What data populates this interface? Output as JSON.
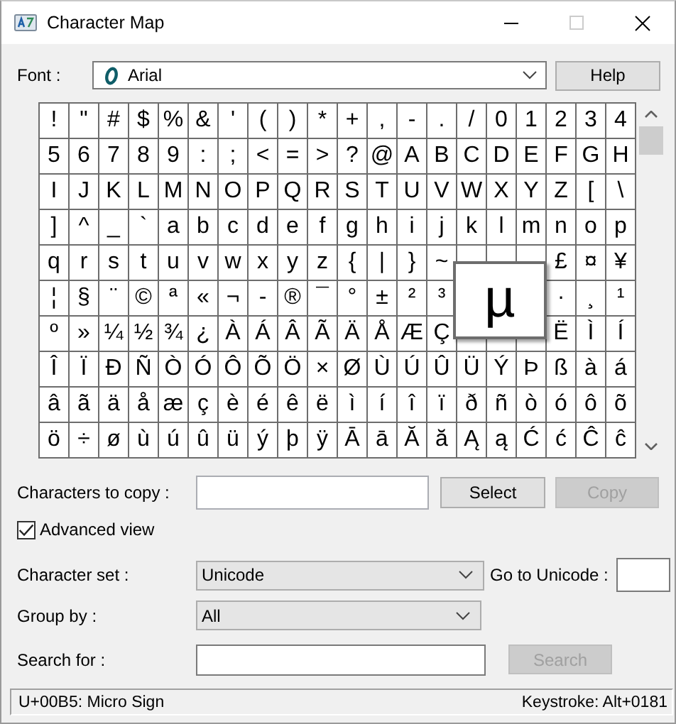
{
  "window": {
    "title": "Character Map",
    "controls": [
      {
        "kind": "minimize",
        "disabled": false
      },
      {
        "kind": "maximize",
        "disabled": true
      },
      {
        "kind": "close",
        "disabled": false
      }
    ]
  },
  "font": {
    "label": "Font :",
    "value": "Arial"
  },
  "help_button": {
    "label": "Help"
  },
  "grid": {
    "rows": [
      [
        "!",
        "\"",
        "#",
        "$",
        "%",
        "&",
        "'",
        "(",
        ")",
        "*",
        "+",
        ",",
        "-",
        ".",
        "/",
        "0",
        "1",
        "2",
        "3",
        "4"
      ],
      [
        "5",
        "6",
        "7",
        "8",
        "9",
        ":",
        ";",
        "<",
        "=",
        ">",
        "?",
        "@",
        "A",
        "B",
        "C",
        "D",
        "E",
        "F",
        "G",
        "H"
      ],
      [
        "I",
        "J",
        "K",
        "L",
        "M",
        "N",
        "O",
        "P",
        "Q",
        "R",
        "S",
        "T",
        "U",
        "V",
        "W",
        "X",
        "Y",
        "Z",
        "[",
        "\\"
      ],
      [
        "]",
        "^",
        "_",
        "`",
        "a",
        "b",
        "c",
        "d",
        "e",
        "f",
        "g",
        "h",
        "i",
        "j",
        "k",
        "l",
        "m",
        "n",
        "o",
        "p"
      ],
      [
        "q",
        "r",
        "s",
        "t",
        "u",
        "v",
        "w",
        "x",
        "y",
        "z",
        "{",
        "|",
        "}",
        "~",
        null,
        null,
        null,
        "£",
        "¤",
        "¥"
      ],
      [
        "¦",
        "§",
        "¨",
        "©",
        "ª",
        "«",
        "¬",
        "-",
        "®",
        "¯",
        "°",
        "±",
        "²",
        "³",
        null,
        null,
        null,
        "·",
        "¸",
        "¹"
      ],
      [
        "º",
        "»",
        "¼",
        "½",
        "¾",
        "¿",
        "À",
        "Á",
        "Â",
        "Ã",
        "Ä",
        "Å",
        "Æ",
        "Ç",
        null,
        null,
        null,
        "Ë",
        "Ì",
        "Í"
      ],
      [
        "Î",
        "Ï",
        "Ð",
        "Ñ",
        "Ò",
        "Ó",
        "Ô",
        "Õ",
        "Ö",
        "×",
        "Ø",
        "Ù",
        "Ú",
        "Û",
        "Ü",
        "Ý",
        "Þ",
        "ß",
        "à",
        "á"
      ],
      [
        "â",
        "ã",
        "ä",
        "å",
        "æ",
        "ç",
        "è",
        "é",
        "ê",
        "ë",
        "ì",
        "í",
        "î",
        "ï",
        "ð",
        "ñ",
        "ò",
        "ó",
        "ô",
        "õ"
      ],
      [
        "ö",
        "÷",
        "ø",
        "ù",
        "ú",
        "û",
        "ü",
        "ý",
        "þ",
        "ÿ",
        "Ā",
        "ā",
        "Ă",
        "ă",
        "Ą",
        "ą",
        "Ć",
        "ć",
        "Ĉ",
        "ĉ"
      ]
    ],
    "magnifier": {
      "char": "µ"
    }
  },
  "copy": {
    "label": "Characters to copy :"
  },
  "select_button": {
    "label": "Select",
    "disabled": false
  },
  "copy_button": {
    "label": "Copy",
    "disabled": true
  },
  "advanced_view": {
    "label": "Advanced view",
    "checked": true
  },
  "character_set": {
    "label": "Character set :",
    "value": "Unicode"
  },
  "go_to_unicode": {
    "label": "Go to Unicode :"
  },
  "group_by": {
    "label": "Group by :",
    "value": "All"
  },
  "search": {
    "label": "Search for :"
  },
  "search_button": {
    "label": "Search",
    "disabled": true
  },
  "status_bar": {
    "left": "U+00B5: Micro Sign",
    "right": "Keystroke: Alt+0181"
  }
}
